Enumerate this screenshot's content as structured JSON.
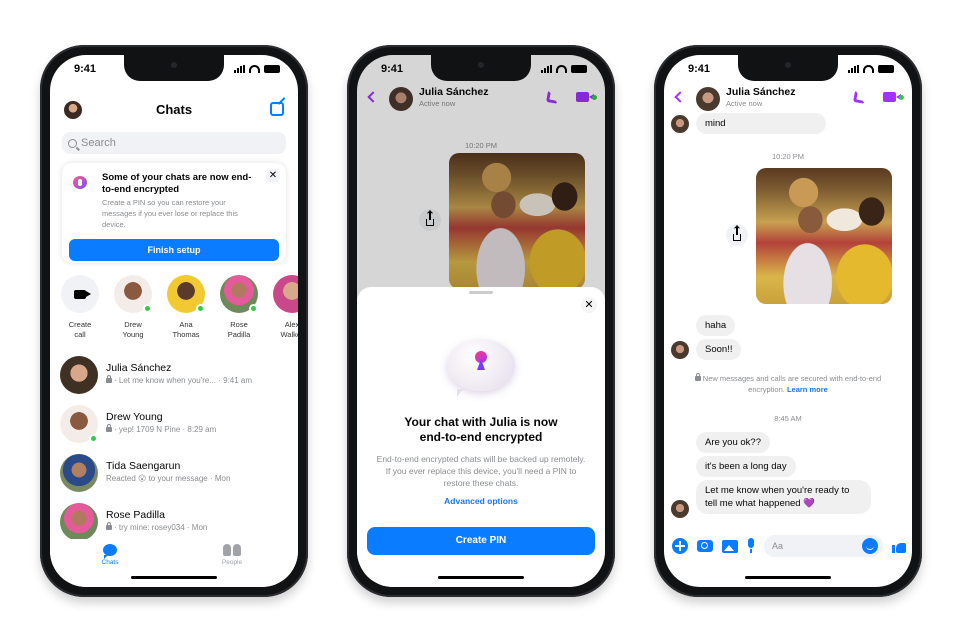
{
  "status_time": "9:41",
  "colors": {
    "brand_blue": "#0a7cff",
    "accent_purple": "#a033ff",
    "online_green": "#31cc46"
  },
  "phone1": {
    "header": {
      "title": "Chats",
      "compose_icon": "compose-icon",
      "profile_icon": "avatar"
    },
    "search": {
      "placeholder": "Search"
    },
    "e2e_card": {
      "title": "Some of your chats are now end-to-end encrypted",
      "body": "Create a PIN so you can restore your messages if you ever lose or replace this device.",
      "close_label": "✕",
      "button_label": "Finish setup"
    },
    "stories": [
      {
        "label_1": "Create",
        "label_2": "call",
        "type": "create-call"
      },
      {
        "label_1": "Drew",
        "label_2": "Young",
        "online": true
      },
      {
        "label_1": "Ana",
        "label_2": "Thomas",
        "online": true
      },
      {
        "label_1": "Rose",
        "label_2": "Padilla",
        "online": true
      },
      {
        "label_1": "Alex",
        "label_2": "Walker",
        "online": false
      }
    ],
    "chats": [
      {
        "name": "Julia Sánchez",
        "preview": "· Let me know when you're... · 9:41 am",
        "locked": true
      },
      {
        "name": "Drew Young",
        "preview": "· yep! 1709 N Pine · 8:29 am",
        "locked": true,
        "online": true
      },
      {
        "name": "Tida Saengarun",
        "preview": "Reacted 😮 to your message · Mon",
        "locked": false
      },
      {
        "name": "Rose Padilla",
        "preview": "· try mine: rosey034 · Mon",
        "locked": true
      }
    ],
    "tabs": [
      {
        "label": "Chats",
        "active": true
      },
      {
        "label": "People",
        "active": false
      }
    ]
  },
  "phone2": {
    "header": {
      "name": "Julia Sánchez",
      "status": "Active now"
    },
    "timestamp": "10:20 PM",
    "sheet": {
      "close_label": "✕",
      "title_line1": "Your chat with Julia is now",
      "title_line2": "end-to-end encrypted",
      "body": "End-to-end encrypted chats will be backed up remotely. If you ever replace this device, you'll need a PIN to restore these chats.",
      "link": "Advanced options",
      "button": "Create PIN"
    }
  },
  "phone3": {
    "header": {
      "name": "Julia Sánchez",
      "status": "Active now"
    },
    "messages_top": [
      {
        "text": "mind"
      }
    ],
    "timestamp_1": "10:20 PM",
    "messages_mid": [
      {
        "text": "haha"
      },
      {
        "text": "Soon!!"
      }
    ],
    "notice": "New messages and calls are secured with end-to-end encryption.",
    "notice_link": "Learn more",
    "timestamp_2": "8:45 AM",
    "messages_bottom": [
      {
        "text": "Are you ok??"
      },
      {
        "text": "it's been a long day"
      },
      {
        "text": "Let me know when you're ready to tell me what happened 💜"
      }
    ],
    "composer": {
      "placeholder": "Aa"
    }
  }
}
